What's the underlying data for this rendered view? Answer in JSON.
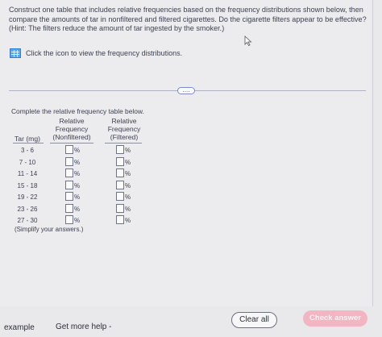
{
  "question": {
    "text": "Construct one table that includes relative frequencies based on the frequency distributions shown below, then compare the amounts of tar in nonfiltered and filtered cigarettes. Do the cigarette filters appear to be effective? (Hint: The filters reduce the amount of tar ingested by the smoker.)",
    "icon_link_text": "Click the icon to view the frequency distributions."
  },
  "more_button_label": "....",
  "instruction": "Complete the relative frequency table below.",
  "table": {
    "headers": {
      "tar": "Tar (mg)",
      "nonfiltered": [
        "Relative",
        "Frequency",
        "(Nonfiltered)"
      ],
      "filtered": [
        "Relative",
        "Frequency",
        "(Filtered)"
      ]
    },
    "rows": [
      {
        "tar": "3 - 6"
      },
      {
        "tar": "7 - 10"
      },
      {
        "tar": "11 - 14"
      },
      {
        "tar": "15 - 18"
      },
      {
        "tar": "19 - 22"
      },
      {
        "tar": "23 - 26"
      },
      {
        "tar": "27 - 30"
      }
    ],
    "unit": "%"
  },
  "simplify_note": "(Simplify your answers.)",
  "footer": {
    "example_label": "example",
    "help_label": "Get more help -",
    "clear_label": "Clear all",
    "check_label": "Check answer"
  },
  "colors": {
    "check_button": "#f2b6c2",
    "icon_blue": "#5aa6ea",
    "accent": "#7d89c9"
  }
}
